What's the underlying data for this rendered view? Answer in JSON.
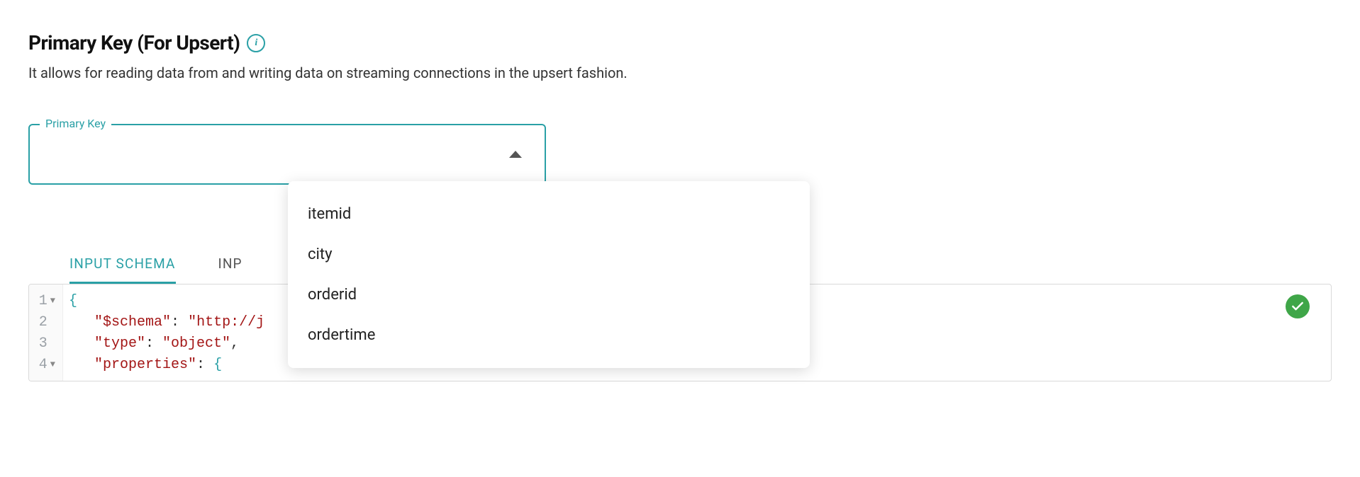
{
  "heading": "Primary Key (For Upsert)",
  "subtext": "It allows for reading data from and writing data on streaming connections in the upsert fashion.",
  "primaryKeySelect": {
    "legend": "Primary Key",
    "value": "",
    "options": [
      "itemid",
      "city",
      "orderid",
      "ordertime"
    ]
  },
  "tabs": [
    {
      "label": "INPUT SCHEMA",
      "active": true
    },
    {
      "label": "INP",
      "active": false
    }
  ],
  "editor": {
    "lines": [
      {
        "num": "1",
        "foldable": true,
        "tokens": [
          {
            "t": "brace",
            "v": "{"
          }
        ]
      },
      {
        "num": "2",
        "foldable": false,
        "tokens": [
          {
            "t": "indent",
            "v": "   "
          },
          {
            "t": "key",
            "v": "\"$schema\""
          },
          {
            "t": "punct",
            "v": ": "
          },
          {
            "t": "string",
            "v": "\"http://j"
          }
        ]
      },
      {
        "num": "3",
        "foldable": false,
        "tokens": [
          {
            "t": "indent",
            "v": "   "
          },
          {
            "t": "key",
            "v": "\"type\""
          },
          {
            "t": "punct",
            "v": ": "
          },
          {
            "t": "string",
            "v": "\"object\""
          },
          {
            "t": "punct",
            "v": ","
          }
        ]
      },
      {
        "num": "4",
        "foldable": true,
        "tokens": [
          {
            "t": "indent",
            "v": "   "
          },
          {
            "t": "key",
            "v": "\"properties\""
          },
          {
            "t": "punct",
            "v": ": "
          },
          {
            "t": "brace",
            "v": "{"
          }
        ]
      }
    ]
  }
}
